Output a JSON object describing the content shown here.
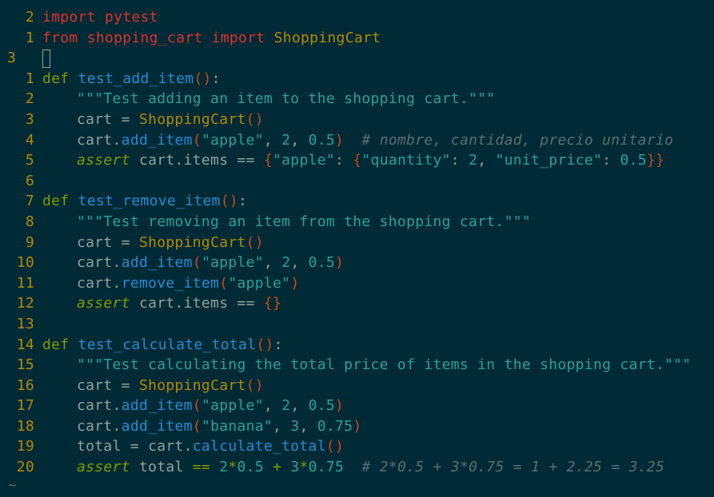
{
  "editor": {
    "lines": [
      {
        "num": "2",
        "tokens": [
          [
            "kw-red",
            "import"
          ],
          [
            "plain",
            " "
          ],
          [
            "mod",
            "pytest"
          ]
        ]
      },
      {
        "num": "1",
        "tokens": [
          [
            "kw-red",
            "from"
          ],
          [
            "plain",
            " "
          ],
          [
            "mod",
            "shopping_cart"
          ],
          [
            "plain",
            " "
          ],
          [
            "kw-red",
            "import"
          ],
          [
            "plain",
            " "
          ],
          [
            "cls",
            "ShoppingCart"
          ]
        ]
      },
      {
        "num": "3",
        "current": true,
        "tokens": []
      },
      {
        "num": "1",
        "tokens": [
          [
            "kw-green",
            "def"
          ],
          [
            "plain",
            " "
          ],
          [
            "fn",
            "test_add_item"
          ],
          [
            "paren",
            "()"
          ],
          [
            "plain",
            ":"
          ]
        ]
      },
      {
        "num": "2",
        "indent": true,
        "tokens": [
          [
            "str",
            "\"\"\"Test adding an item to the shopping cart.\"\"\""
          ]
        ]
      },
      {
        "num": "3",
        "indent": true,
        "tokens": [
          [
            "plain",
            "cart = "
          ],
          [
            "cls",
            "ShoppingCart"
          ],
          [
            "paren",
            "()"
          ]
        ]
      },
      {
        "num": "4",
        "indent": true,
        "tokens": [
          [
            "plain",
            "cart."
          ],
          [
            "fn",
            "add_item"
          ],
          [
            "paren",
            "("
          ],
          [
            "str",
            "\"apple\""
          ],
          [
            "plain",
            ", "
          ],
          [
            "num",
            "2"
          ],
          [
            "plain",
            ", "
          ],
          [
            "num",
            "0.5"
          ],
          [
            "paren",
            ")"
          ],
          [
            "plain",
            "  "
          ],
          [
            "cmt",
            "# nombre, cantidad, precio unitario"
          ]
        ]
      },
      {
        "num": "5",
        "indent": true,
        "tokens": [
          [
            "assert",
            "assert"
          ],
          [
            "plain",
            " cart.items == "
          ],
          [
            "paren",
            "{"
          ],
          [
            "str",
            "\"apple\""
          ],
          [
            "plain",
            ": "
          ],
          [
            "paren",
            "{"
          ],
          [
            "str",
            "\"quantity\""
          ],
          [
            "plain",
            ": "
          ],
          [
            "num",
            "2"
          ],
          [
            "plain",
            ", "
          ],
          [
            "str",
            "\"unit_price\""
          ],
          [
            "plain",
            ": "
          ],
          [
            "num",
            "0.5"
          ],
          [
            "paren",
            "}}"
          ]
        ]
      },
      {
        "num": "6",
        "tokens": []
      },
      {
        "num": "7",
        "tokens": [
          [
            "kw-green",
            "def"
          ],
          [
            "plain",
            " "
          ],
          [
            "fn",
            "test_remove_item"
          ],
          [
            "paren",
            "()"
          ],
          [
            "plain",
            ":"
          ]
        ]
      },
      {
        "num": "8",
        "indent": true,
        "tokens": [
          [
            "str",
            "\"\"\"Test removing an item from the shopping cart.\"\"\""
          ]
        ]
      },
      {
        "num": "9",
        "indent": true,
        "tokens": [
          [
            "plain",
            "cart = "
          ],
          [
            "cls",
            "ShoppingCart"
          ],
          [
            "paren",
            "()"
          ]
        ]
      },
      {
        "num": "10",
        "indent": true,
        "tokens": [
          [
            "plain",
            "cart."
          ],
          [
            "fn",
            "add_item"
          ],
          [
            "paren",
            "("
          ],
          [
            "str",
            "\"apple\""
          ],
          [
            "plain",
            ", "
          ],
          [
            "num",
            "2"
          ],
          [
            "plain",
            ", "
          ],
          [
            "num",
            "0.5"
          ],
          [
            "paren",
            ")"
          ]
        ]
      },
      {
        "num": "11",
        "indent": true,
        "tokens": [
          [
            "plain",
            "cart."
          ],
          [
            "fn",
            "remove_item"
          ],
          [
            "paren",
            "("
          ],
          [
            "str",
            "\"apple\""
          ],
          [
            "paren",
            ")"
          ]
        ]
      },
      {
        "num": "12",
        "indent": true,
        "tokens": [
          [
            "assert",
            "assert"
          ],
          [
            "plain",
            " cart.items == "
          ],
          [
            "paren",
            "{}"
          ]
        ]
      },
      {
        "num": "13",
        "tokens": []
      },
      {
        "num": "14",
        "tokens": [
          [
            "kw-green",
            "def"
          ],
          [
            "plain",
            " "
          ],
          [
            "fn",
            "test_calculate_total"
          ],
          [
            "paren",
            "()"
          ],
          [
            "plain",
            ":"
          ]
        ]
      },
      {
        "num": "15",
        "indent": true,
        "tokens": [
          [
            "str",
            "\"\"\"Test calculating the total price of items in the shopping cart.\"\"\""
          ]
        ]
      },
      {
        "num": "16",
        "indent": true,
        "tokens": [
          [
            "plain",
            "cart = "
          ],
          [
            "cls",
            "ShoppingCart"
          ],
          [
            "paren",
            "()"
          ]
        ]
      },
      {
        "num": "17",
        "indent": true,
        "tokens": [
          [
            "plain",
            "cart."
          ],
          [
            "fn",
            "add_item"
          ],
          [
            "paren",
            "("
          ],
          [
            "str",
            "\"apple\""
          ],
          [
            "plain",
            ", "
          ],
          [
            "num",
            "2"
          ],
          [
            "plain",
            ", "
          ],
          [
            "num",
            "0.5"
          ],
          [
            "paren",
            ")"
          ]
        ]
      },
      {
        "num": "18",
        "indent": true,
        "tokens": [
          [
            "plain",
            "cart."
          ],
          [
            "fn",
            "add_item"
          ],
          [
            "paren",
            "("
          ],
          [
            "str",
            "\"banana\""
          ],
          [
            "plain",
            ", "
          ],
          [
            "num",
            "3"
          ],
          [
            "plain",
            ", "
          ],
          [
            "num",
            "0.75"
          ],
          [
            "paren",
            ")"
          ]
        ]
      },
      {
        "num": "19",
        "indent": true,
        "tokens": [
          [
            "plain",
            "total = cart."
          ],
          [
            "fn",
            "calculate_total"
          ],
          [
            "paren",
            "()"
          ]
        ]
      },
      {
        "num": "20",
        "indent": true,
        "tokens": [
          [
            "assert",
            "assert"
          ],
          [
            "plain",
            " total "
          ],
          [
            "op",
            "=="
          ],
          [
            "plain",
            " "
          ],
          [
            "num",
            "2"
          ],
          [
            "op",
            "*"
          ],
          [
            "num",
            "0.5"
          ],
          [
            "plain",
            " "
          ],
          [
            "op",
            "+"
          ],
          [
            "plain",
            " "
          ],
          [
            "num",
            "3"
          ],
          [
            "op",
            "*"
          ],
          [
            "num",
            "0.75"
          ],
          [
            "plain",
            "  "
          ],
          [
            "cmt",
            "# 2*0.5 + 3*0.75 = 1 + 2.25 = 3.25"
          ]
        ]
      }
    ],
    "end_marker": "~"
  },
  "colors": {
    "background": "#002b36",
    "line_number": "#b58900",
    "keyword": "#859900",
    "import_keyword": "#dc322f",
    "function": "#268bd2",
    "string": "#2aa198",
    "comment": "#586e75"
  }
}
